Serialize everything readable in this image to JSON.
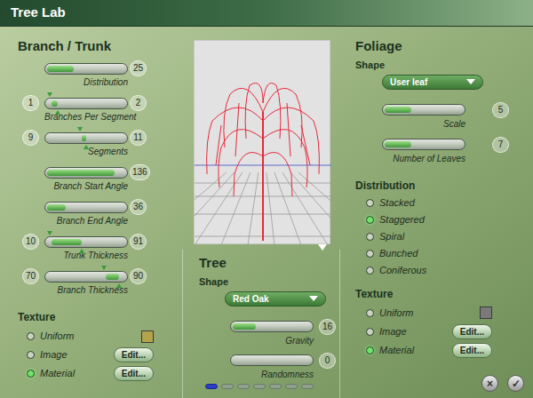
{
  "window": {
    "title": "Tree Lab"
  },
  "branch_trunk": {
    "heading": "Branch / Trunk",
    "sliders": [
      {
        "kind": "single",
        "label": "Distribution",
        "value": "25",
        "level": 0.35
      },
      {
        "kind": "range",
        "label": "Branches Per Segment",
        "low_value": "1",
        "high_value": "2",
        "low_level": 0.05,
        "high_level": 0.15
      },
      {
        "kind": "range",
        "label": "Segments",
        "low_value": "9",
        "high_value": "11",
        "low_level": 0.42,
        "high_level": 0.5
      },
      {
        "kind": "single",
        "label": "Branch Start Angle",
        "value": "136",
        "level": 0.85
      },
      {
        "kind": "single",
        "label": "Branch End Angle",
        "value": "36",
        "level": 0.25
      },
      {
        "kind": "range",
        "label": "Trunk Thickness",
        "low_value": "10",
        "high_value": "91",
        "low_level": 0.05,
        "high_level": 0.45
      },
      {
        "kind": "range",
        "label": "Branch Thickness",
        "low_value": "70",
        "high_value": "90",
        "low_level": 0.72,
        "high_level": 0.9
      }
    ],
    "texture": {
      "heading": "Texture",
      "options": [
        {
          "label": "Uniform",
          "selected": false,
          "kind": "swatch",
          "swatch_color": "#b3a44a"
        },
        {
          "label": "Image",
          "selected": false,
          "kind": "edit",
          "button": "Edit..."
        },
        {
          "label": "Material",
          "selected": true,
          "kind": "edit",
          "button": "Edit..."
        }
      ]
    }
  },
  "tree": {
    "heading": "Tree",
    "shape_label": "Shape",
    "shape_value": "Red Oak",
    "sliders": [
      {
        "kind": "single",
        "label": "Gravity",
        "value": "16",
        "level": 0.3
      },
      {
        "kind": "single",
        "label": "Randomness",
        "value": "0",
        "level": 0
      }
    ]
  },
  "foliage": {
    "heading": "Foliage",
    "shape_label": "Shape",
    "shape_value": "User leaf",
    "sliders": [
      {
        "kind": "single",
        "label": "Scale",
        "value": "5",
        "level": 0.35
      },
      {
        "kind": "single",
        "label": "Number of Leaves",
        "value": "7",
        "level": 0.35
      }
    ],
    "distribution": {
      "heading": "Distribution",
      "options": [
        {
          "label": "Stacked",
          "selected": false
        },
        {
          "label": "Staggered",
          "selected": true
        },
        {
          "label": "Spiral",
          "selected": false
        },
        {
          "label": "Bunched",
          "selected": false
        },
        {
          "label": "Coniferous",
          "selected": false
        }
      ]
    },
    "texture": {
      "heading": "Texture",
      "options": [
        {
          "label": "Uniform",
          "selected": false,
          "kind": "swatch",
          "swatch_color": "#7a7a7a"
        },
        {
          "label": "Image",
          "selected": false,
          "kind": "edit",
          "button": "Edit..."
        },
        {
          "label": "Material",
          "selected": true,
          "kind": "edit",
          "button": "Edit..."
        }
      ]
    }
  },
  "pages": [
    {
      "selected": true
    },
    {
      "selected": false
    },
    {
      "selected": false
    },
    {
      "selected": false
    },
    {
      "selected": false
    },
    {
      "selected": false
    },
    {
      "selected": false
    }
  ],
  "buttons": [
    {
      "label": "×",
      "kind": "cancel"
    },
    {
      "label": "✓",
      "kind": "ok"
    }
  ]
}
